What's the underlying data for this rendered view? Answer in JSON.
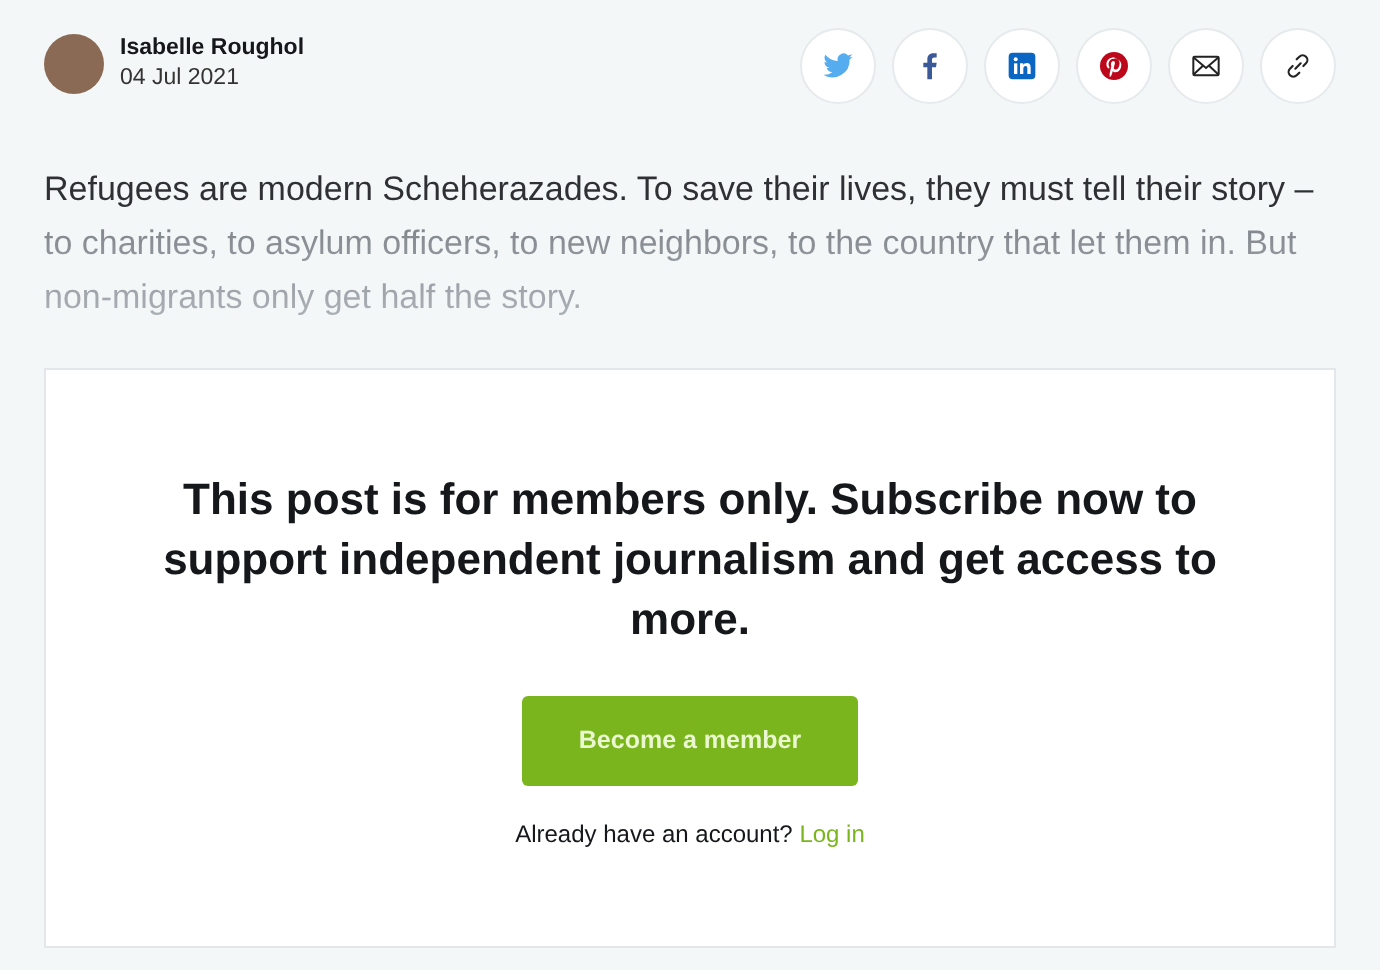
{
  "author": {
    "name": "Isabelle Roughol",
    "date": "04 Jul 2021"
  },
  "excerpt": "Refugees are modern Scheherazades. To save their lives, they must tell their story –  to charities, to asylum officers, to new neighbors, to the country that let them in. But non-migrants only get half the story.",
  "paywall": {
    "heading": "This post is for members only. Subscribe now to support independent journalism and get access to more.",
    "button": "Become a member",
    "signin_prompt": "Already have an account?",
    "signin_link": "Log in"
  }
}
